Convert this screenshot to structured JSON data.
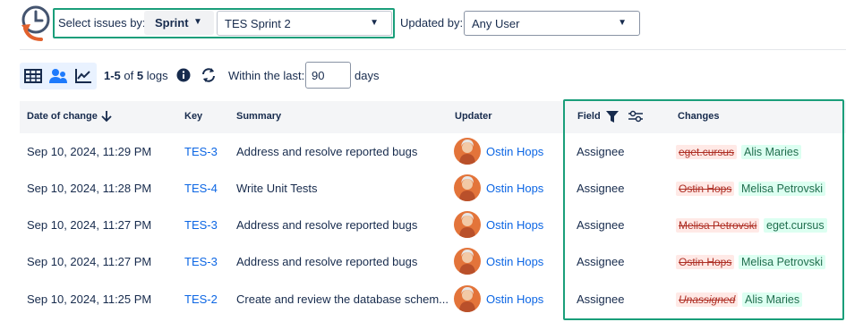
{
  "filters": {
    "select_label": "Select issues by:",
    "select_by": "Sprint",
    "sprint_value": "TES Sprint 2",
    "updated_label": "Updated by:",
    "updated_value": "Any User"
  },
  "toolbar": {
    "range_prefix": "1-5",
    "range_of": " of ",
    "total": "5",
    "logs_word": " logs",
    "within_label": "Within the last:",
    "days_value": "90",
    "days_label": "days"
  },
  "columns": {
    "date": "Date of change",
    "key": "Key",
    "summary": "Summary",
    "updater": "Updater",
    "field": "Field",
    "changes": "Changes"
  },
  "rows": [
    {
      "date": "Sep 10, 2024, 11:29 PM",
      "key": "TES-3",
      "summary": "Address and resolve reported bugs",
      "updater": "Ostin Hops",
      "field": "Assignee",
      "old": "eget.cursus",
      "new": "Alis Maries"
    },
    {
      "date": "Sep 10, 2024, 11:28 PM",
      "key": "TES-4",
      "summary": "Write Unit Tests",
      "updater": "Ostin Hops",
      "field": "Assignee",
      "old": "Ostin Hops",
      "new": "Melisa Petrovski"
    },
    {
      "date": "Sep 10, 2024, 11:27 PM",
      "key": "TES-3",
      "summary": "Address and resolve reported bugs",
      "updater": "Ostin Hops",
      "field": "Assignee",
      "old": "Melisa Petrovski",
      "new": "eget.cursus"
    },
    {
      "date": "Sep 10, 2024, 11:27 PM",
      "key": "TES-3",
      "summary": "Address and resolve reported bugs",
      "updater": "Ostin Hops",
      "field": "Assignee",
      "old": "Ostin Hops",
      "new": "Melisa Petrovski"
    },
    {
      "date": "Sep 10, 2024, 11:25 PM",
      "key": "TES-2",
      "summary": "Create and review the database schem...",
      "updater": "Ostin Hops",
      "field": "Assignee",
      "old": "Unassigned",
      "new": "Alis Maries"
    }
  ],
  "icons": {
    "logo": "clock-history-icon",
    "views": [
      "table-icon",
      "users-icon",
      "chart-icon"
    ],
    "info": "info-icon",
    "refresh": "refresh-icon",
    "sort": "arrow-down-icon",
    "filter": "filter-icon",
    "settings": "sliders-icon"
  },
  "colors": {
    "highlight": "#1a9e7a",
    "link": "#0c66e4",
    "removed": "#ae2e24",
    "added": "#216e4e"
  }
}
